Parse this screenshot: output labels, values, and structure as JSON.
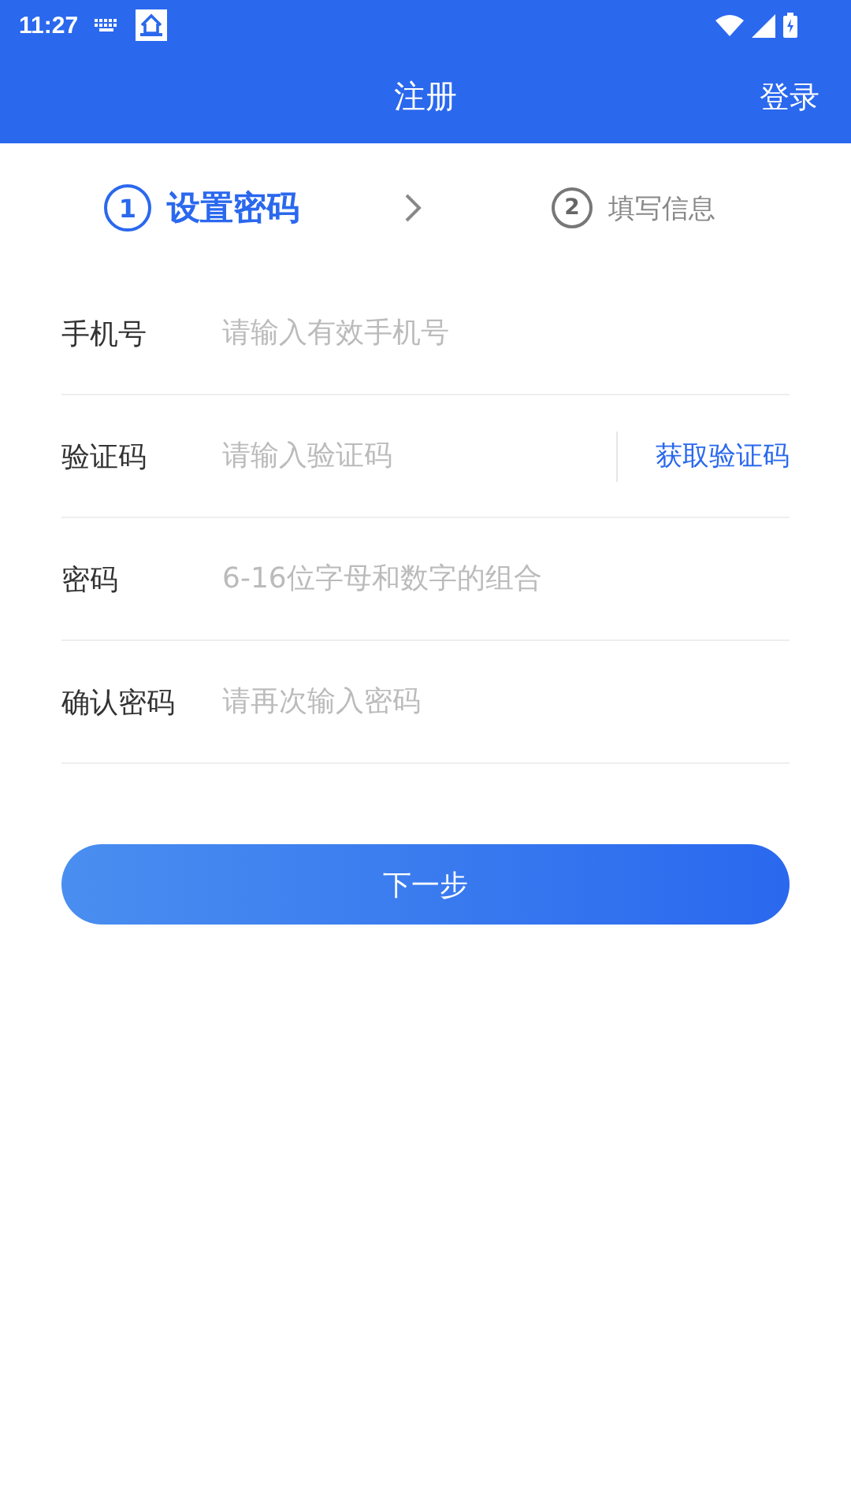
{
  "status_bar": {
    "time": "11:27"
  },
  "header": {
    "title": "注册",
    "action": "登录"
  },
  "steps": [
    {
      "number": "1",
      "label": "设置密码",
      "selected": true
    },
    {
      "number": "2",
      "label": "填写信息",
      "selected": false
    }
  ],
  "fields": [
    {
      "label": "手机号",
      "placeholder": "请输入有效手机号"
    },
    {
      "label": "验证码",
      "placeholder": "请输入验证码",
      "action": "获取验证码"
    },
    {
      "label": "密码",
      "placeholder": "6-16位字母和数字的组合"
    },
    {
      "label": "确认密码",
      "placeholder": "请再次输入密码"
    }
  ],
  "submit": "下一步"
}
